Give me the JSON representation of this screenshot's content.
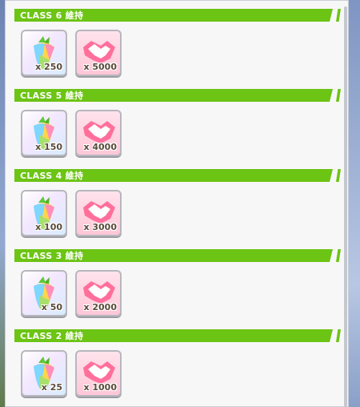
{
  "sections": [
    {
      "title": "CLASS 6 維持",
      "items": [
        {
          "icon": "rainbow-carrot-icon",
          "qty": "x 250"
        },
        {
          "icon": "pink-handshake-icon",
          "qty": "x 5000"
        }
      ]
    },
    {
      "title": "CLASS 5 維持",
      "items": [
        {
          "icon": "rainbow-carrot-icon",
          "qty": "x 150"
        },
        {
          "icon": "pink-handshake-icon",
          "qty": "x 4000"
        }
      ]
    },
    {
      "title": "CLASS 4 維持",
      "items": [
        {
          "icon": "rainbow-carrot-icon",
          "qty": "x 100"
        },
        {
          "icon": "pink-handshake-icon",
          "qty": "x 3000"
        }
      ]
    },
    {
      "title": "CLASS 3 維持",
      "items": [
        {
          "icon": "rainbow-carrot-icon",
          "qty": "x 50"
        },
        {
          "icon": "pink-handshake-icon",
          "qty": "x 2000"
        }
      ]
    },
    {
      "title": "CLASS 2 維持",
      "items": [
        {
          "icon": "rainbow-carrot-icon",
          "qty": "x 25"
        },
        {
          "icon": "pink-handshake-icon",
          "qty": "x 1000"
        }
      ]
    }
  ],
  "colors": {
    "header_green": "#6cc414",
    "panel_bg": "#f7f7f8"
  }
}
